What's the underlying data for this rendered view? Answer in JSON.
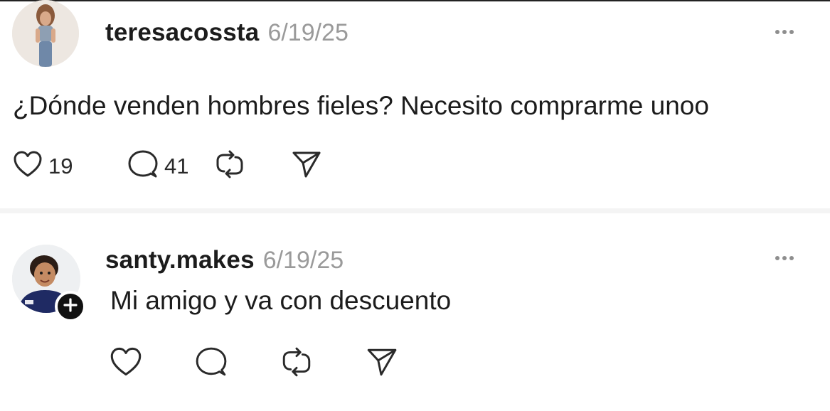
{
  "posts": [
    {
      "username": "teresacossta",
      "date": "6/19/25",
      "text": "¿Dónde venden hombres fieles? Necesito comprarme unoo",
      "likes": "19",
      "replies": "41",
      "icons": [
        "heart-icon",
        "comment-icon",
        "repost-icon",
        "share-icon",
        "more-icon"
      ]
    },
    {
      "username": "santy.makes",
      "date": "6/19/25",
      "text": "Mi amigo y va con descuento",
      "likes": "",
      "replies": "",
      "icons": [
        "heart-icon",
        "comment-icon",
        "repost-icon",
        "share-icon",
        "more-icon",
        "follow-plus-icon"
      ]
    }
  ],
  "colors": {
    "text": "#1c1c1c",
    "muted": "#9a9a9a",
    "icon": "#2a2a2a",
    "background": "#ffffff"
  }
}
